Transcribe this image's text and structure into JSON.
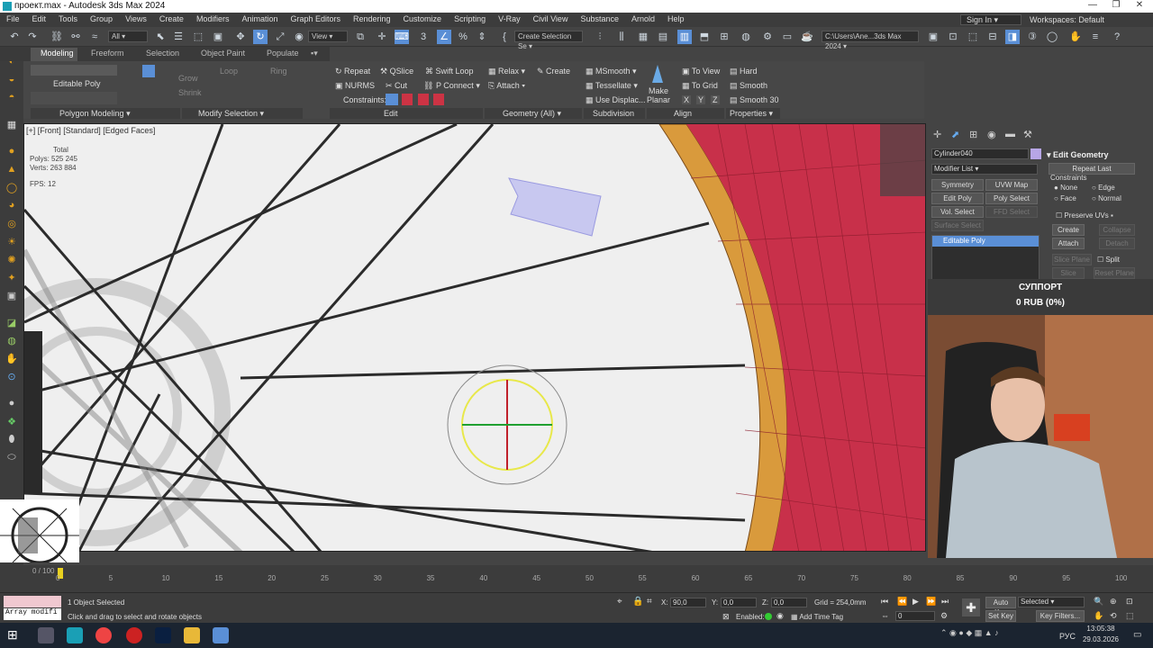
{
  "titlebar": {
    "title": "проект.max - Autodesk 3ds Max 2024"
  },
  "menu": [
    "File",
    "Edit",
    "Tools",
    "Group",
    "Views",
    "Create",
    "Modifiers",
    "Animation",
    "Graph Editors",
    "Rendering",
    "Customize",
    "Scripting",
    "V-Ray",
    "Civil View",
    "Substance",
    "Arnold",
    "Help"
  ],
  "account": {
    "signin": "Sign In",
    "workspaces": "Workspaces: Default"
  },
  "toolbar": {
    "filter": "All",
    "view": "View",
    "selection_set": "Create Selection Se",
    "path": "C:\\Users\\Ane...3ds Max 2024"
  },
  "ribbon": {
    "tabs": [
      "Modeling",
      "Freeform",
      "Selection",
      "Object Paint",
      "Populate"
    ],
    "editable_poly": "Editable Poly",
    "grow": "Grow",
    "shrink": "Shrink",
    "loop": "Loop",
    "ring": "Ring",
    "repeat": "Repeat",
    "qslice": "QSlice",
    "swift_loop": "Swift Loop",
    "nurms": "NURMS",
    "cut": "Cut",
    "p_connect": "P Connect",
    "constraints": "Constraints:",
    "relax": "Relax",
    "create": "Create",
    "attach": "Attach",
    "msmooth": "MSmooth",
    "tessellate": "Tessellate",
    "use_displac": "Use Displac...",
    "make_planar_1": "Make",
    "make_planar_2": "Planar",
    "to_view": "To View",
    "to_grid": "To Grid",
    "x": "X",
    "y": "Y",
    "z": "Z",
    "hard": "Hard",
    "smooth": "Smooth",
    "smooth30": "Smooth 30",
    "groups": [
      "Polygon Modeling",
      "Modify Selection",
      "Edit",
      "Geometry (All)",
      "Subdivision",
      "Align",
      "Properties"
    ]
  },
  "viewport": {
    "label": "[+] [Front] [Standard] [Edged Faces]",
    "stats_total": "Total",
    "polys": "Polys: 525 245",
    "verts": "Verts: 263 884",
    "fps": "FPS:    12"
  },
  "cmdpanel": {
    "object_name": "Cylinder040",
    "modifier_list": "Modifier List",
    "buttons": [
      "Symmetry",
      "UVW Map",
      "Edit Poly",
      "Poly Select",
      "Vol. Select",
      "FFD Select",
      "Surface Select"
    ],
    "stack_item": "Editable Poly",
    "rollout": "Edit Geometry",
    "repeat_last": "Repeat Last",
    "constraints": "Constraints",
    "opts": [
      "None",
      "Edge",
      "Face",
      "Normal"
    ],
    "preserve_uvs": "Preserve UVs",
    "create": "Create",
    "collapse": "Collapse",
    "attach": "Attach",
    "detach": "Detach",
    "slice_plane": "Slice Plane",
    "split": "Split",
    "slice": "Slice",
    "reset_plane": "Reset Plane"
  },
  "donation": {
    "title": "СУППОРТ",
    "amount": "0 RUB (0%)",
    "min": "0",
    "max": "100",
    "progress": 0
  },
  "timeline": {
    "frame": "0 / 100",
    "ticks": [
      "0",
      "5",
      "10",
      "15",
      "20",
      "25",
      "30",
      "35",
      "40",
      "45",
      "50",
      "55",
      "60",
      "65",
      "70",
      "75",
      "80",
      "85",
      "90",
      "95",
      "100"
    ]
  },
  "status": {
    "maxscript": "Array modifi",
    "selected": "1 Object Selected",
    "prompt": "Click and drag to select and rotate objects",
    "x_label": "X:",
    "x": "90,0",
    "y_label": "Y:",
    "y": "0,0",
    "z_label": "Z:",
    "z": "0,0",
    "grid": "Grid = 254,0mm",
    "enabled": "Enabled:",
    "add_time_tag": "Add Time Tag",
    "auto_key": "Auto Key",
    "set_key": "Set Key",
    "selected_dropdown": "Selected",
    "key_filters": "Key Filters...",
    "frame_field": "0"
  },
  "taskbar": {
    "lang": "РУС",
    "time": "13:05:38",
    "date": "29.03.2026"
  },
  "colors": {
    "accent": "#5a8fd6",
    "tire": "#c8304a",
    "rim": "#d99a3c"
  }
}
